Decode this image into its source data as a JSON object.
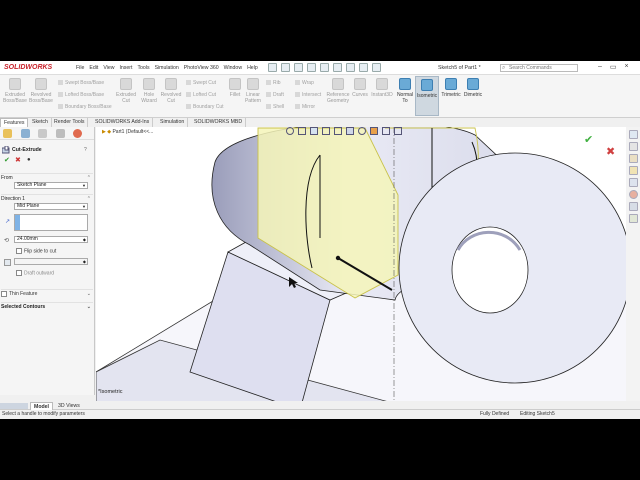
{
  "app": {
    "logo": "SOLIDWORKS",
    "document_title": "Sketch5 of Part1 *"
  },
  "menu": [
    "File",
    "Edit",
    "View",
    "Insert",
    "Tools",
    "Simulation",
    "PhotoView 360",
    "Window",
    "Help"
  ],
  "search": {
    "placeholder": "Search Commands"
  },
  "ribbon": {
    "large": [
      {
        "label": "Extruded\nBoss/Base"
      },
      {
        "label": "Revolved\nBoss/Base"
      },
      {
        "label": "Extruded\nCut"
      },
      {
        "label": "Hole\nWizard"
      },
      {
        "label": "Revolved\nCut"
      },
      {
        "label": "Fillet"
      },
      {
        "label": "Linear\nPattern"
      },
      {
        "label": "Reference\nGeometry"
      },
      {
        "label": "Curves"
      },
      {
        "label": "Instant3D"
      },
      {
        "label": "Normal\nTo"
      },
      {
        "label": "Isometric"
      },
      {
        "label": "Trimetric"
      },
      {
        "label": "Dimetric"
      }
    ],
    "small": [
      "Swept Boss/Base",
      "Lofted Boss/Base",
      "Boundary Boss/Base",
      "Swept Cut",
      "Lofted Cut",
      "Boundary Cut",
      "Rib",
      "Draft",
      "Shell",
      "Wrap",
      "Intersect",
      "Mirror"
    ]
  },
  "tabs": [
    "Features",
    "Sketch",
    "Render Tools",
    "SOLIDWORKS Add-Ins",
    "Simulation",
    "SOLIDWORKS MBD"
  ],
  "tree": {
    "item": "Part1  (Default<<..."
  },
  "property_manager": {
    "title": "Cut-Extrude",
    "from_label": "From",
    "from_value": "Sketch Plane",
    "direction_label": "Direction 1",
    "direction_value": "Mid Plane",
    "depth": "24.00mm",
    "flip_label": "Flip side to cut",
    "draft_label": "Draft outward",
    "thin_label": "Thin Feature",
    "contours_label": "Selected Contours"
  },
  "viewport": {
    "view_label": "*Isometric"
  },
  "bottom_tabs": [
    "Model",
    "3D Views"
  ],
  "status": {
    "message": "Select a handle to modify parameters",
    "defined": "Fully Defined",
    "editing": "Editing Sketch5"
  },
  "colors": {
    "accent": "#c8202a",
    "selection": "#f2f2a0",
    "model": "#eaecf6"
  }
}
